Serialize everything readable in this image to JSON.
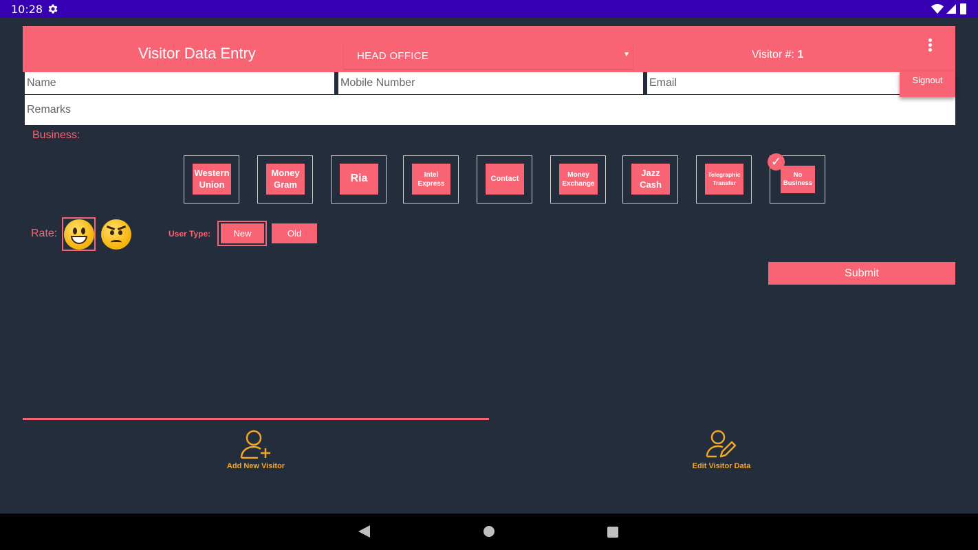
{
  "status_bar": {
    "time": "10:28"
  },
  "toolbar": {
    "title": "Visitor Data Entry",
    "branch": "HEAD OFFICE",
    "visitor_label": "Visitor #: ",
    "visitor_number": "1",
    "menu_item": "Signout"
  },
  "form": {
    "name_placeholder": "Name",
    "mobile_placeholder": "Mobile Number",
    "email_placeholder": "Email",
    "remarks_placeholder": "Remarks"
  },
  "business": {
    "label": "Business:",
    "options": [
      {
        "line1": "Western",
        "line2": "Union",
        "selected": false
      },
      {
        "line1": "Money",
        "line2": "Gram",
        "selected": false
      },
      {
        "line1": "Ria",
        "line2": "",
        "selected": false
      },
      {
        "line1": "Intel",
        "line2": "Express",
        "selected": false
      },
      {
        "line1": "Contact",
        "line2": "",
        "selected": false
      },
      {
        "line1": "Money",
        "line2": "Exchange",
        "selected": false
      },
      {
        "line1": "Jazz",
        "line2": "Cash",
        "selected": false
      },
      {
        "line1": "Telegraphic",
        "line2": "Transfer",
        "selected": false
      },
      {
        "line1": "No",
        "line2": "Business",
        "selected": true
      }
    ]
  },
  "rating": {
    "label": "Rate:",
    "selected": "happy"
  },
  "user_type": {
    "label": "User Type:",
    "new_label": "New",
    "old_label": "Old",
    "selected": "New"
  },
  "submit_label": "Submit",
  "bottom_nav": {
    "add_label": "Add New Visitor",
    "edit_label": "Edit Visitor Data",
    "active": "add"
  },
  "colors": {
    "accent": "#f86474",
    "background": "#232d3c",
    "nav_icon": "#f5a623",
    "status_bar": "#3700b3"
  }
}
